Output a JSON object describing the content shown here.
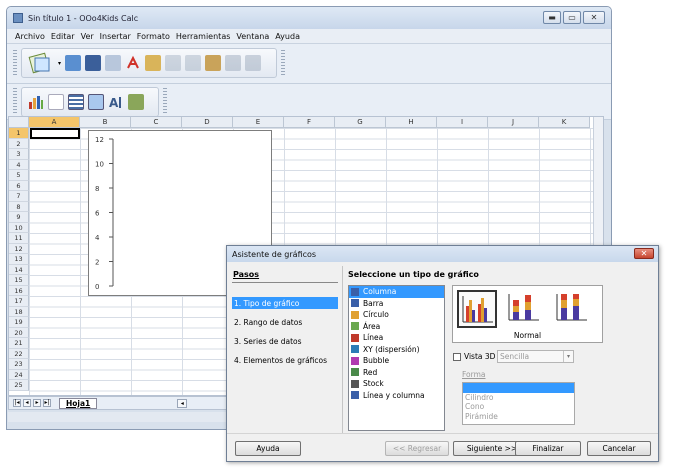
{
  "window": {
    "title": "Sin título 1 - OOo4Kids Calc",
    "minimize": "▬",
    "maximize": "▭",
    "close": "✕"
  },
  "menu": [
    "Archivo",
    "Editar",
    "Ver",
    "Insertar",
    "Formato",
    "Herramientas",
    "Ventana",
    "Ayuda"
  ],
  "sheet": {
    "columns": [
      "A",
      "B",
      "C",
      "D",
      "E",
      "F",
      "G",
      "H",
      "I",
      "J",
      "K"
    ],
    "rows": [
      "1",
      "2",
      "3",
      "4",
      "5",
      "6",
      "7",
      "8",
      "9",
      "10",
      "11",
      "12",
      "13",
      "14",
      "15",
      "16",
      "17",
      "18",
      "19",
      "20",
      "21",
      "22",
      "23",
      "24",
      "25"
    ],
    "tab": "Hoja1"
  },
  "chart_data": {
    "type": "bar",
    "yticks": [
      "12",
      "10",
      "8",
      "6",
      "4",
      "2",
      "0"
    ]
  },
  "dialog": {
    "title": "Asistente de gráficos",
    "close": "✕",
    "steps_title": "Pasos",
    "steps": [
      "1. Tipo de gráfico",
      "2. Rango de datos",
      "3. Series de datos",
      "4. Elementos de gráficos"
    ],
    "content_title": "Seleccione un tipo de gráfico",
    "chart_types": [
      "Columna",
      "Barra",
      "Círculo",
      "Área",
      "Línea",
      "XY (dispersión)",
      "Bubble",
      "Red",
      "Stock",
      "Línea y columna"
    ],
    "variant_label": "Normal",
    "vista3d": "Vista 3D",
    "select3d": "Sencilla",
    "forma": "Forma",
    "shapes": [
      "",
      "Cilindro",
      "Cono",
      "Pirámide"
    ],
    "buttons": {
      "help": "Ayuda",
      "back": "<< Regresar",
      "next": "Siguiente >>",
      "finish": "Finalizar",
      "cancel": "Cancelar"
    }
  }
}
